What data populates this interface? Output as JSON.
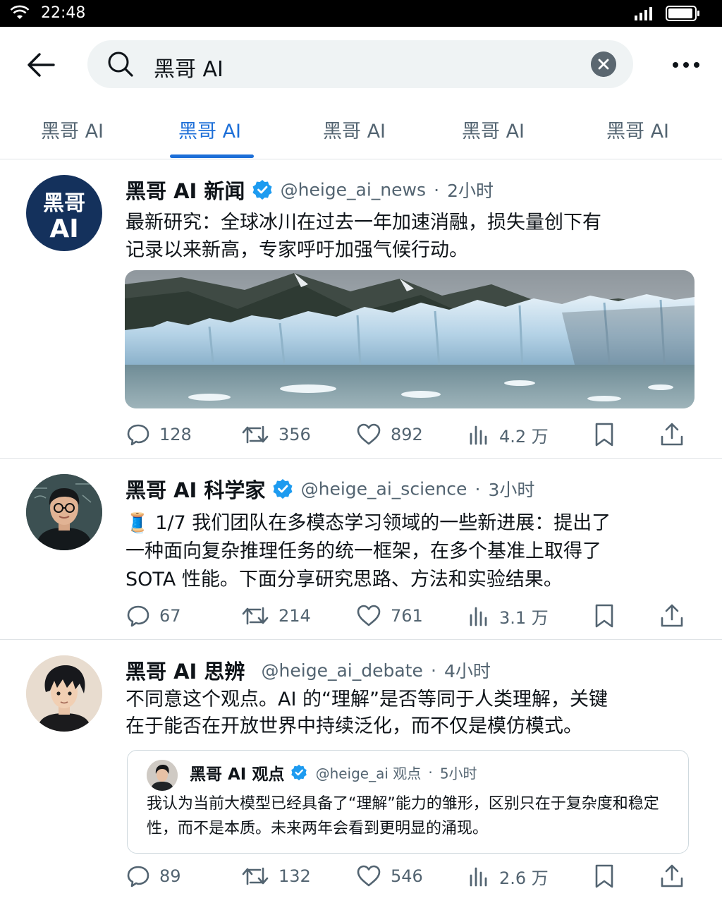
{
  "status_bar": {
    "time": "22:48"
  },
  "search": {
    "query": "黑哥 AI"
  },
  "tabs": [
    {
      "label": "黑哥 AI",
      "active": false
    },
    {
      "label": "黑哥 AI",
      "active": true
    },
    {
      "label": "黑哥 AI",
      "active": false
    },
    {
      "label": "黑哥 AI",
      "active": false
    },
    {
      "label": "黑哥 AI",
      "active": false
    }
  ],
  "posts": [
    {
      "name": "黑哥 AI 新闻",
      "verified": true,
      "handle": "@heige_ai_news",
      "time": "2小时",
      "text": "最新研究：全球冰川在过去一年加速消融，损失量创下有记录以来新高，专家呼吁加强气候行动。",
      "avatar_text": "黑哥 AI",
      "media": "glacier-photo",
      "stats": {
        "replies": "128",
        "reposts": "356",
        "likes": "892",
        "views": "4.2 万"
      }
    },
    {
      "name": "黑哥 AI 科学家",
      "verified": true,
      "handle": "@heige_ai_science",
      "time": "3小时",
      "text": "🧵 1/7 我们团队在多模态学习领域的一些新进展：提出了一种面向复杂推理任务的统一框架，在多个基准上取得了 SOTA 性能。下面分享研究思路、方法和实验结果。",
      "stats": {
        "replies": "67",
        "reposts": "214",
        "likes": "761",
        "views": "3.1 万"
      }
    },
    {
      "name": "黑哥 AI 思辨",
      "verified": false,
      "handle": "@heige_ai_debate",
      "time": "4小时",
      "text": "不同意这个观点。AI 的“理解”是否等同于人类理解，关键在于能否在开放世界中持续泛化，而不仅是模仿模式。",
      "quote": {
        "name": "黑哥 AI 观点",
        "verified": true,
        "handle": "@heige_ai 观点",
        "time": "5小时",
        "text": "我认为当前大模型已经具备了“理解”能力的雏形，区别只在于复杂度和稳定性，而不是本质。未来两年会看到更明显的涌现。"
      },
      "stats": {
        "replies": "89",
        "reposts": "132",
        "likes": "546",
        "views": "2.6 万"
      }
    }
  ],
  "colors": {
    "accent": "#1d6fd8",
    "verified": "#1d9bf0",
    "muted": "#536471",
    "news_avatar_bg": "#14315c"
  }
}
